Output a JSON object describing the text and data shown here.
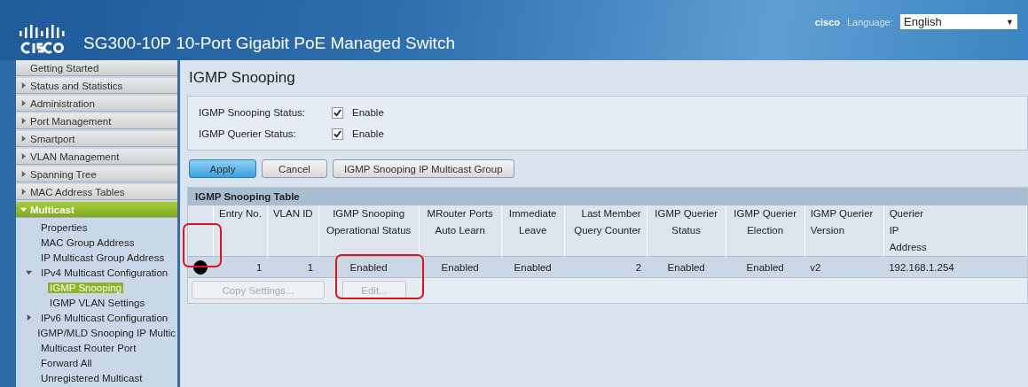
{
  "header": {
    "title": "SG300-10P 10-Port Gigabit PoE Managed Switch",
    "user": "cisco",
    "language_label": "Language:",
    "language": "English",
    "dropdown_arrow": "▼"
  },
  "sidebar": {
    "items": [
      {
        "label": "Getting Started",
        "has_arrow": false,
        "selected": false
      },
      {
        "label": "Status and Statistics",
        "expanded": false,
        "has_arrow": true,
        "selected": false
      },
      {
        "label": "Administration",
        "expanded": false,
        "has_arrow": true,
        "selected": false
      },
      {
        "label": "Port Management",
        "expanded": false,
        "has_arrow": true,
        "selected": false
      },
      {
        "label": "Smartport",
        "expanded": false,
        "has_arrow": true,
        "selected": false
      },
      {
        "label": "VLAN Management",
        "expanded": false,
        "has_arrow": true,
        "selected": false
      },
      {
        "label": "Spanning Tree",
        "expanded": false,
        "has_arrow": true,
        "selected": false
      },
      {
        "label": "MAC Address Tables",
        "expanded": false,
        "has_arrow": true,
        "selected": false
      },
      {
        "label": "Multicast",
        "expanded": true,
        "has_arrow": true,
        "selected": true,
        "children": [
          {
            "label": "Properties",
            "selected": false
          },
          {
            "label": "MAC Group Address",
            "selected": false
          },
          {
            "label": "IP Multicast Group Address",
            "selected": false
          },
          {
            "label": "IPv4 Multicast Configuration",
            "selected": false,
            "expanded": true,
            "children": [
              {
                "label": "IGMP Snooping",
                "selected": true
              },
              {
                "label": "IGMP VLAN Settings",
                "selected": false
              }
            ]
          },
          {
            "label": "IPv6 Multicast Configuration",
            "selected": false,
            "expanded": false
          },
          {
            "label": "IGMP/MLD Snooping IP Multic",
            "selected": false
          },
          {
            "label": "Multicast Router Port",
            "selected": false
          },
          {
            "label": "Forward All",
            "selected": false
          },
          {
            "label": "Unregistered Multicast",
            "selected": false
          }
        ]
      }
    ]
  },
  "page": {
    "title": "IGMP Snooping",
    "settings": [
      {
        "label": "IGMP Snooping Status:",
        "checked": true,
        "option": "Enable"
      },
      {
        "label": "IGMP Querier Status:",
        "checked": true,
        "option": "Enable"
      }
    ],
    "buttons": [
      {
        "label": "Apply",
        "kind": "primary"
      },
      {
        "label": "Cancel",
        "kind": "normal"
      },
      {
        "label": "IGMP Snooping IP Multicast Group",
        "kind": "normal"
      }
    ],
    "table": {
      "title": "IGMP Snooping Table",
      "columns": [
        "Entry No.",
        "VLAN ID",
        "IGMP Snooping Operational Status",
        "MRouter Ports Auto Learn",
        "Immediate Leave",
        "Last Member Query Counter",
        "IGMP Querier Status",
        "IGMP Querier Election",
        "IGMP Querier Version",
        "Querier IP Address"
      ],
      "rows": [
        {
          "selected": true,
          "cells": [
            "1",
            "1",
            "Enabled",
            "Enabled",
            "Enabled",
            "2",
            "Enabled",
            "Enabled",
            "v2",
            "192.168.1.254"
          ]
        }
      ],
      "buttons": [
        {
          "label": "Copy Settings...",
          "disabled": true
        },
        {
          "label": "Edit...",
          "disabled": true
        }
      ]
    }
  }
}
